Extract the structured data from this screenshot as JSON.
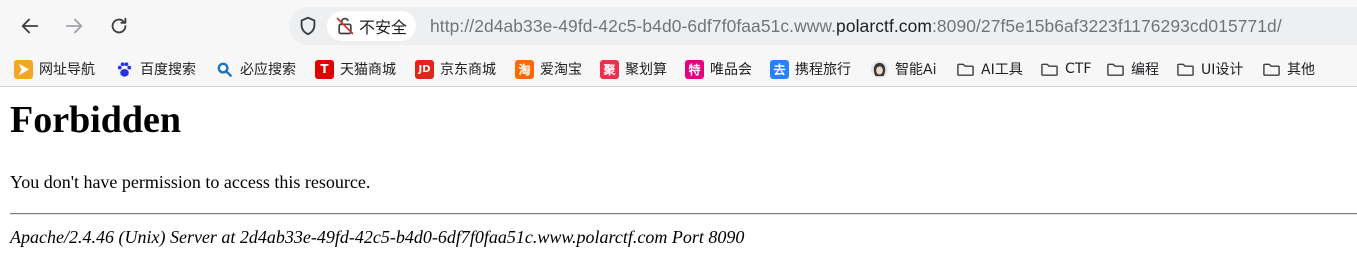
{
  "browser": {
    "nav": {
      "back": "back",
      "forward": "forward",
      "reload": "reload"
    },
    "security_label": "不安全",
    "url": {
      "scheme": "http://",
      "subdomain": "2d4ab33e-49fd-42c5-b4d0-6df7f0faa51c.www.",
      "domain": "polarctf.com",
      "rest": ":8090/27f5e15b6af3223f1176293cd015771d/"
    }
  },
  "bookmarks": [
    {
      "label": "网址导航",
      "icon": "navigation-icon",
      "color": "#f5a623"
    },
    {
      "label": "百度搜索",
      "icon": "baidu-paw-icon",
      "color": "#2932e1"
    },
    {
      "label": "必应搜索",
      "icon": "bing-search-icon",
      "color": "#1e73be"
    },
    {
      "label": "天猫商城",
      "icon": "tmall-icon",
      "color": "#e00000",
      "glyph": "T"
    },
    {
      "label": "京东商城",
      "icon": "jd-icon",
      "color": "#e1251b",
      "glyph": "JD"
    },
    {
      "label": "爱淘宝",
      "icon": "taobao-icon",
      "color": "#ff6a00",
      "glyph": "淘"
    },
    {
      "label": "聚划算",
      "icon": "juhuasuan-icon",
      "color": "#f0304b",
      "glyph": "聚"
    },
    {
      "label": "唯品会",
      "icon": "vip-icon",
      "color": "#e4007f",
      "glyph": "特"
    },
    {
      "label": "携程旅行",
      "icon": "ctrip-icon",
      "color": "#2681ff",
      "glyph": "去"
    },
    {
      "label": "智能Ai",
      "icon": "ai-avatar-icon",
      "color": "#444444"
    },
    {
      "label": "AI工具",
      "icon": "folder-icon"
    },
    {
      "label": "CTF",
      "icon": "folder-icon"
    },
    {
      "label": "编程",
      "icon": "folder-icon"
    },
    {
      "label": "UI设计",
      "icon": "folder-icon"
    },
    {
      "label": "其他",
      "icon": "folder-icon"
    }
  ],
  "page": {
    "title": "Forbidden",
    "message": "You don't have permission to access this resource.",
    "server_signature": "Apache/2.4.46 (Unix) Server at 2d4ab33e-49fd-42c5-b4d0-6df7f0faa51c.www.polarctf.com Port 8090"
  }
}
